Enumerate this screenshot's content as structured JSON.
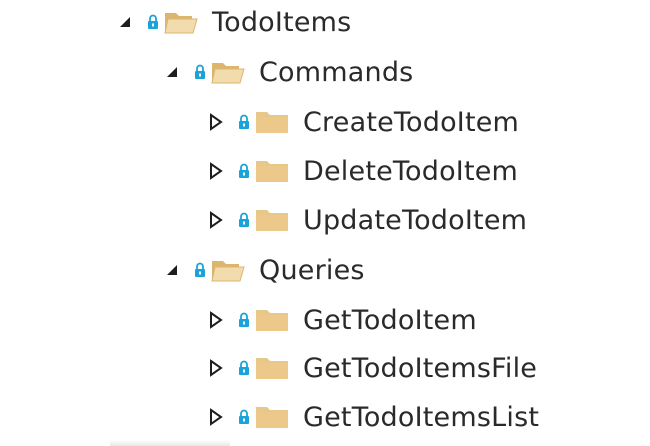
{
  "tree": {
    "root": {
      "label": "TodoItems",
      "expander_icon": "expanded-triangle-icon",
      "lock_icon": "lock-icon",
      "folder_icon": "open-folder-icon",
      "children": [
        {
          "label": "Commands",
          "expander_icon": "expanded-triangle-icon",
          "lock_icon": "lock-icon",
          "folder_icon": "open-folder-icon",
          "children": [
            {
              "label": "CreateTodoItem",
              "expander_icon": "collapsed-triangle-icon",
              "lock_icon": "lock-icon",
              "folder_icon": "folder-icon"
            },
            {
              "label": "DeleteTodoItem",
              "expander_icon": "collapsed-triangle-icon",
              "lock_icon": "lock-icon",
              "folder_icon": "folder-icon"
            },
            {
              "label": "UpdateTodoItem",
              "expander_icon": "collapsed-triangle-icon",
              "lock_icon": "lock-icon",
              "folder_icon": "folder-icon"
            }
          ]
        },
        {
          "label": "Queries",
          "expander_icon": "expanded-triangle-icon",
          "lock_icon": "lock-icon",
          "folder_icon": "open-folder-icon",
          "children": [
            {
              "label": "GetTodoItem",
              "expander_icon": "collapsed-triangle-icon",
              "lock_icon": "lock-icon",
              "folder_icon": "folder-icon"
            },
            {
              "label": "GetTodoItemsFile",
              "expander_icon": "collapsed-triangle-icon",
              "lock_icon": "lock-icon",
              "folder_icon": "folder-icon"
            },
            {
              "label": "GetTodoItemsList",
              "expander_icon": "collapsed-triangle-icon",
              "lock_icon": "lock-icon",
              "folder_icon": "folder-icon"
            }
          ]
        }
      ]
    }
  },
  "colors": {
    "folder_fill": "#e8c88a",
    "folder_tab": "#dcb66e",
    "lock_blue": "#1aa3d9",
    "expander": "#1e1e1e",
    "text": "#2a2a2a",
    "background": "#ffffff"
  }
}
